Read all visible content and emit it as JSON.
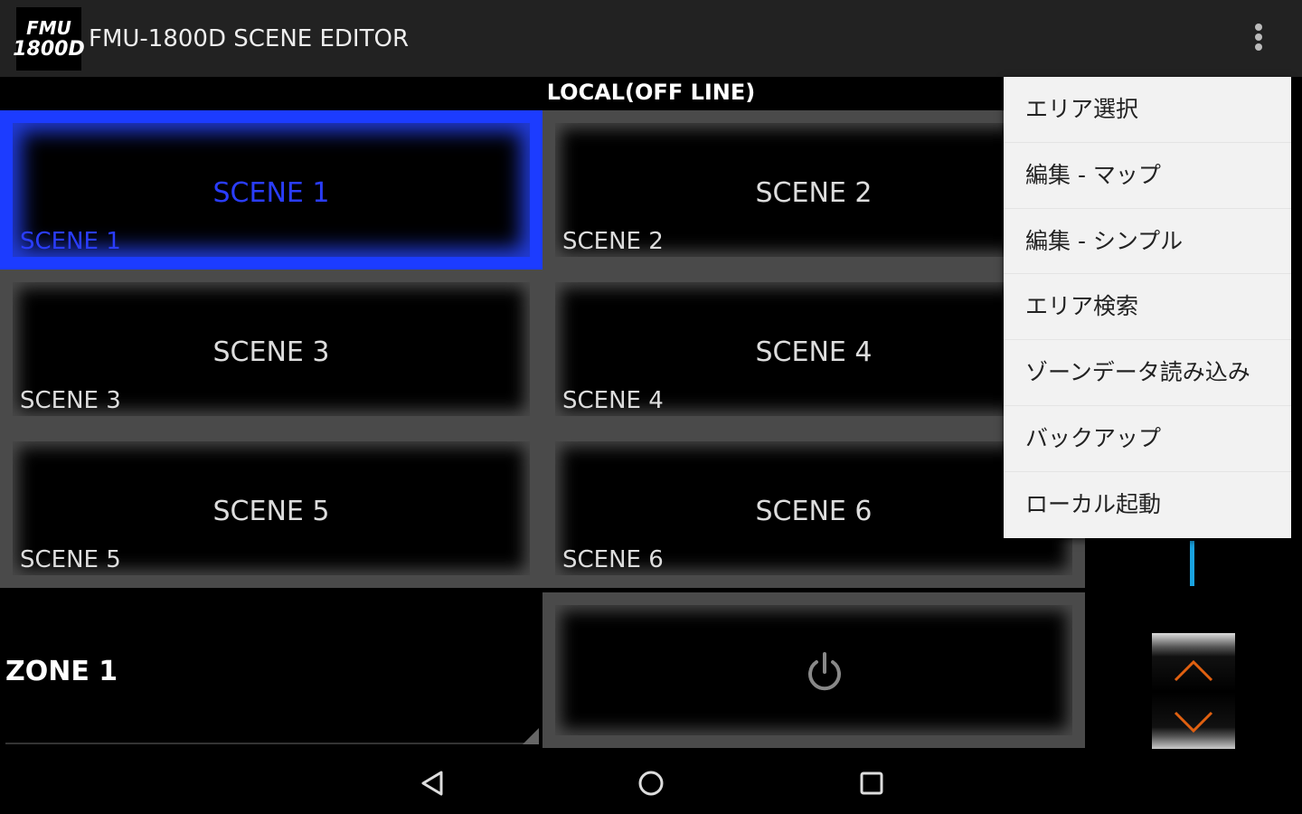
{
  "appbar": {
    "logo_line1": "FMU",
    "logo_line2": "1800D",
    "title": "FMU-1800D SCENE EDITOR"
  },
  "status": "LOCAL(OFF LINE)",
  "scenes": [
    {
      "big": "SCENE 1",
      "small": "SCENE 1",
      "selected": true
    },
    {
      "big": "SCENE 2",
      "small": "SCENE 2",
      "selected": false
    },
    {
      "big": "SCENE 3",
      "small": "SCENE 3",
      "selected": false
    },
    {
      "big": "SCENE 4",
      "small": "SCENE 4",
      "selected": false
    },
    {
      "big": "SCENE 5",
      "small": "SCENE 5",
      "selected": false
    },
    {
      "big": "SCENE 6",
      "small": "SCENE 6",
      "selected": false
    }
  ],
  "zone": {
    "label": "ZONE 1"
  },
  "menu": {
    "items": [
      "エリア選択",
      "編集 - マップ",
      "編集 - シンプル",
      "エリア検索",
      "ゾーンデータ読み込み",
      "バックアップ",
      "ローカル起動"
    ]
  },
  "colors": {
    "selected_accent": "#1c3cff",
    "arrow": "#e06010",
    "scroll_indicator": "#1aa3e0"
  },
  "icons": {
    "overflow": "overflow-menu-icon",
    "power": "power-icon",
    "up": "chevron-up-icon",
    "down": "chevron-down-icon",
    "back": "back-triangle-icon",
    "home": "home-circle-icon",
    "recents": "recents-square-icon"
  }
}
